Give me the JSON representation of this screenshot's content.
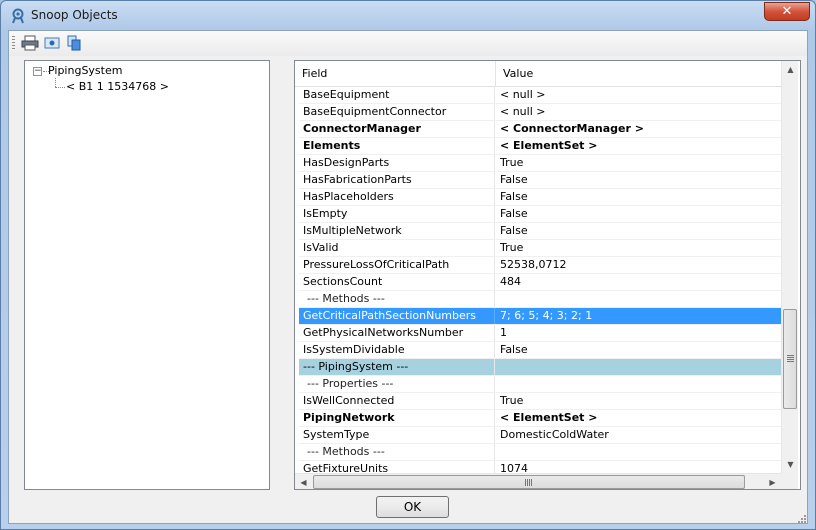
{
  "window": {
    "title": "Snoop Objects",
    "close_label": "✕"
  },
  "toolbar": {
    "buttons": [
      {
        "name": "print-icon",
        "tooltip": ""
      },
      {
        "name": "preview-icon",
        "tooltip": ""
      },
      {
        "name": "copy-icon",
        "tooltip": ""
      }
    ]
  },
  "tree": {
    "root": {
      "label": "PipingSystem",
      "expander": "−"
    },
    "child": {
      "label": "< B1 1  1534768 >"
    }
  },
  "grid": {
    "headers": {
      "field": "Field",
      "value": "Value"
    },
    "rows": [
      {
        "field": "BaseEquipment",
        "value": "< null >",
        "style": ""
      },
      {
        "field": "BaseEquipmentConnector",
        "value": "< null >",
        "style": ""
      },
      {
        "field": "ConnectorManager",
        "value": "< ConnectorManager >",
        "style": "bold"
      },
      {
        "field": "Elements",
        "value": "< ElementSet >",
        "style": "bold"
      },
      {
        "field": "HasDesignParts",
        "value": "True",
        "style": ""
      },
      {
        "field": "HasFabricationParts",
        "value": "False",
        "style": ""
      },
      {
        "field": "HasPlaceholders",
        "value": "False",
        "style": ""
      },
      {
        "field": "IsEmpty",
        "value": "False",
        "style": ""
      },
      {
        "field": "IsMultipleNetwork",
        "value": "False",
        "style": ""
      },
      {
        "field": "IsValid",
        "value": "True",
        "style": ""
      },
      {
        "field": "PressureLossOfCriticalPath",
        "value": "52538,0712",
        "style": ""
      },
      {
        "field": "SectionsCount",
        "value": "484",
        "style": ""
      },
      {
        "field": "  --- Methods ---",
        "value": "",
        "style": "section"
      },
      {
        "field": "GetCriticalPathSectionNumbers",
        "value": "7; 6; 5; 4; 3; 2; 1",
        "style": "selected"
      },
      {
        "field": "GetPhysicalNetworksNumber",
        "value": "1",
        "style": ""
      },
      {
        "field": "IsSystemDividable",
        "value": "False",
        "style": ""
      },
      {
        "field": "--- PipingSystem ---",
        "value": "",
        "style": "category"
      },
      {
        "field": "  --- Properties ---",
        "value": "",
        "style": "section"
      },
      {
        "field": "IsWellConnected",
        "value": "True",
        "style": ""
      },
      {
        "field": "PipingNetwork",
        "value": "< ElementSet >",
        "style": "bold"
      },
      {
        "field": "SystemType",
        "value": "DomesticColdWater",
        "style": ""
      },
      {
        "field": "  --- Methods ---",
        "value": "",
        "style": "section"
      },
      {
        "field": "GetFixtureUnits",
        "value": "1074",
        "style": ""
      }
    ]
  },
  "scrollbars": {
    "up": "▲",
    "down": "▼",
    "left": "◀",
    "right": "▶"
  },
  "footer": {
    "ok_label": "OK"
  },
  "colors": {
    "selected": "#3399ff",
    "category": "#a6d2e0",
    "title_bar": "#b9d0ec"
  }
}
